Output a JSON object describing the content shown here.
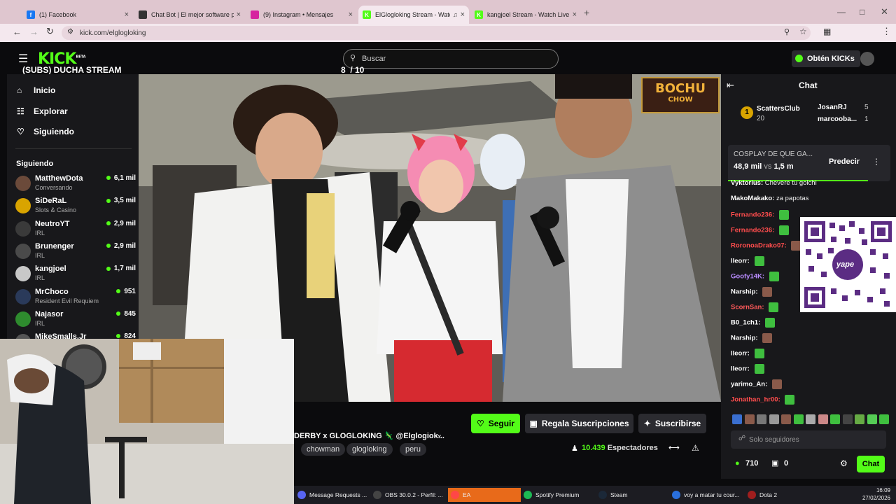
{
  "browser": {
    "tabs": [
      {
        "title": "(1) Facebook",
        "icon": "facebook-icon",
        "color": "#1877f2"
      },
      {
        "title": "Chat Bot | El mejor software pa",
        "icon": "chatbot-icon",
        "color": "#333333"
      },
      {
        "title": "(9) Instagram • Mensajes",
        "icon": "instagram-icon",
        "color": "#d6249f"
      },
      {
        "title": "ElGlogloking Stream - Watc",
        "icon": "kick-icon",
        "color": "#53fc18"
      },
      {
        "title": "kangjoel Stream - Watch Live o",
        "icon": "kick-icon",
        "color": "#53fc18"
      }
    ],
    "url": "kick.com/elglogloking"
  },
  "header": {
    "logo": "KICK",
    "logo_beta": "BETA",
    "search_placeholder": "Buscar",
    "get_kicks": "Obtén KICKs"
  },
  "overlay": {
    "goal_title": "(SUBS) DUCHA STREAM",
    "goal_count": "8  / 10",
    "goal_progress": 0.8,
    "brand": "BOCHU",
    "brand_sub": "CHOW"
  },
  "sidebar": {
    "nav": [
      {
        "label": "Inicio",
        "icon": "home-icon"
      },
      {
        "label": "Explorar",
        "icon": "compass-icon"
      },
      {
        "label": "Siguiendo",
        "icon": "heart-icon"
      }
    ],
    "section_title": "Siguiendo",
    "channels": [
      {
        "name": "MatthewDota",
        "category": "Conversando",
        "viewers": "6,1 mil",
        "color": "#6b4a3a"
      },
      {
        "name": "SiDeRaL",
        "category": "Slots & Casino",
        "viewers": "3,5 mil",
        "color": "#d9a400"
      },
      {
        "name": "NeutroYT",
        "category": "IRL",
        "viewers": "2,9 mil",
        "color": "#3a3a3a"
      },
      {
        "name": "Brunenger",
        "category": "IRL",
        "viewers": "2,9 mil",
        "color": "#4a4a4a"
      },
      {
        "name": "kangjoel",
        "category": "IRL",
        "viewers": "1,7 mil",
        "color": "#c8c8c8"
      },
      {
        "name": "MrChoco",
        "category": "Resident Evil Requiem",
        "viewers": "951",
        "color": "#2a3a5a"
      },
      {
        "name": "Najasor",
        "category": "IRL",
        "viewers": "845",
        "color": "#2e8b2e"
      },
      {
        "name": "MikeSmalls.Jr",
        "category": "",
        "viewers": "824",
        "color": "#555555"
      }
    ]
  },
  "stream": {
    "title": "DERBY x GLOGLOKING 🦎 @Elglogiok...",
    "tags": [
      "chowman",
      "glogloking",
      "peru"
    ],
    "follow": "Seguir",
    "gift": "Regala Suscripciones",
    "subscribe": "Suscribirse",
    "viewers": "10.439",
    "viewers_label": "Espectadores"
  },
  "chat": {
    "title": "Chat",
    "leaderboard": [
      {
        "rank": "1",
        "name": "ScattersClub",
        "value": "20"
      },
      {
        "name": "JosanRJ",
        "value": "5"
      },
      {
        "name": "marcooba...",
        "value": "1"
      }
    ],
    "prediction": {
      "title": "COSPLAY DE QUE GA...",
      "a": "48,9 mil",
      "vs": "vs",
      "b": "1,5 m",
      "button": "Predecir"
    },
    "messages": [
      {
        "user": "Vyktorius:",
        "text": "Chevere tu golchi",
        "color": "#ffffff"
      },
      {
        "user": "MakoMakako:",
        "text": "za papotas",
        "color": "#ffffff"
      },
      {
        "user": "Fernando236:",
        "text": "",
        "color": "#ff4d4d"
      },
      {
        "user": "Fernando236:",
        "text": "",
        "color": "#ff4d4d"
      },
      {
        "user": "RoronoaDrako07:",
        "text": "",
        "color": "#ff4d4d"
      },
      {
        "user": "lleorr:",
        "text": "",
        "color": "#ffffff"
      },
      {
        "user": "Goofy14K:",
        "text": "",
        "color": "#b98cff"
      },
      {
        "user": "Narship:",
        "text": "",
        "color": "#ffffff"
      },
      {
        "user": "ScornSan:",
        "text": "",
        "color": "#ff5a5a"
      },
      {
        "user": "B0_1ch1:",
        "text": "",
        "color": "#ffffff"
      },
      {
        "user": "Narship:",
        "text": "",
        "color": "#ffffff"
      },
      {
        "user": "lleorr:",
        "text": "",
        "color": "#ffffff"
      },
      {
        "user": "lleorr:",
        "text": "",
        "color": "#ffffff"
      },
      {
        "user": "yarimo_An:",
        "text": "",
        "color": "#ffffff"
      },
      {
        "user": "Jonathan_hr00:",
        "text": "",
        "color": "#ff4d4d"
      }
    ],
    "qr_label": "yape",
    "input_placeholder": "Solo seguidores",
    "points": "710",
    "gifts": "0",
    "send": "Chat"
  },
  "taskbar": {
    "items": [
      {
        "label": "Message Requests ...",
        "color": "#5865f2"
      },
      {
        "label": "OBS 30.0.2 - Perfil: ...",
        "color": "#444444"
      },
      {
        "label": "EA",
        "color": "#ff4747"
      },
      {
        "label": "Spotify Premium",
        "color": "#1db954"
      },
      {
        "label": "Steam",
        "color": "#1b2838"
      },
      {
        "label": "voy a matar tu cour...",
        "color": "#2a6fdb"
      },
      {
        "label": "Dota 2",
        "color": "#a01e1e"
      }
    ],
    "time": "16:09",
    "date": "27/02/2026"
  }
}
